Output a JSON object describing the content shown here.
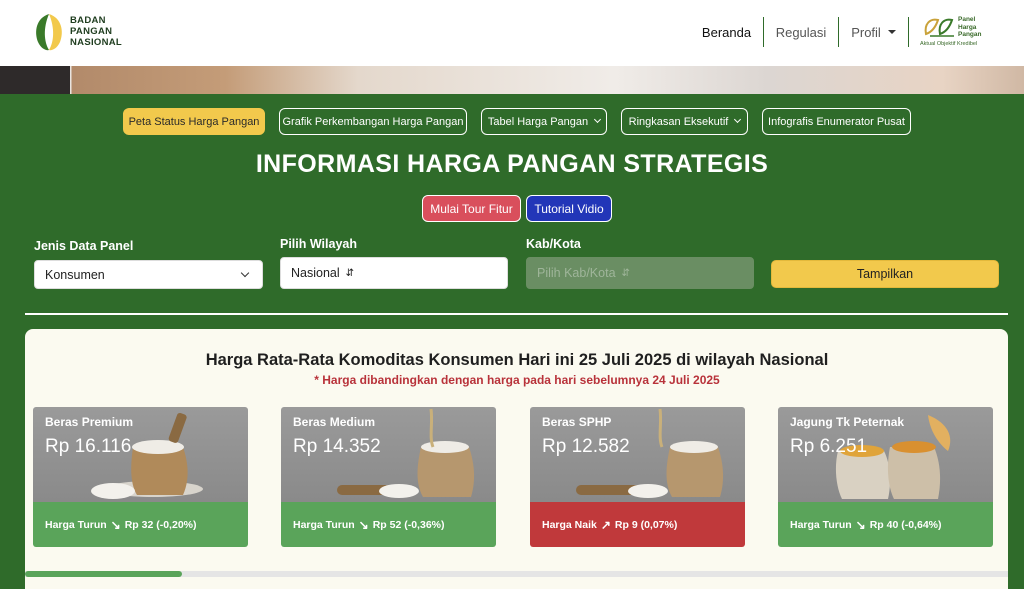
{
  "header": {
    "logo_lines": [
      "BADAN",
      "PANGAN",
      "NASIONAL"
    ],
    "nav": {
      "beranda": "Beranda",
      "regulasi": "Regulasi",
      "profil": "Profil"
    },
    "panel_logo": {
      "lines": [
        "Panel",
        "Harga",
        "Pangan"
      ],
      "tagline": "Aktual Objektif Kredibel"
    }
  },
  "tabs": [
    {
      "label": "Peta Status Harga Pangan",
      "active": true
    },
    {
      "label": "Grafik Perkembangan Harga Pangan",
      "active": false
    },
    {
      "label": "Tabel Harga Pangan",
      "active": false,
      "dropdown": true
    },
    {
      "label": "Ringkasan Eksekutif",
      "active": false,
      "dropdown": true
    },
    {
      "label": "Infografis Enumerator Pusat",
      "active": false
    }
  ],
  "main_title": "INFORMASI HARGA PANGAN STRATEGIS",
  "buttons": {
    "tour": "Mulai Tour Fitur",
    "video": "Tutorial Vidio",
    "show": "Tampilkan"
  },
  "filters": {
    "jenis": {
      "label": "Jenis Data Panel",
      "value": "Konsumen"
    },
    "wilayah": {
      "label": "Pilih Wilayah",
      "value": "Nasional"
    },
    "kabkota": {
      "label": "Kab/Kota",
      "placeholder": "Pilih Kab/Kota"
    }
  },
  "summary": {
    "title": "Harga Rata-Rata Komoditas Konsumen Hari ini 25 Juli 2025 di wilayah Nasional",
    "subtitle": "* Harga dibandingkan dengan harga pada hari sebelumnya 24 Juli 2025"
  },
  "cards": [
    {
      "name": "Beras Premium",
      "price": "Rp 16.116",
      "status": "Harga Turun",
      "direction": "down",
      "change": "Rp 32 (-0,20%)",
      "color": "#5aa45a"
    },
    {
      "name": "Beras Medium",
      "price": "Rp 14.352",
      "status": "Harga Turun",
      "direction": "down",
      "change": "Rp 52 (-0,36%)",
      "color": "#5aa45a"
    },
    {
      "name": "Beras SPHP",
      "price": "Rp 12.582",
      "status": "Harga Naik",
      "direction": "up",
      "change": "Rp 9 (0,07%)",
      "color": "#c0393b"
    },
    {
      "name": "Jagung Tk Peternak",
      "price": "Rp 6.251",
      "status": "Harga Turun",
      "direction": "down",
      "change": "Rp 40 (-0,64%)",
      "color": "#5aa45a"
    }
  ],
  "colors": {
    "primary_green": "#2f6b2a",
    "accent_yellow": "#f2c94c",
    "up_red": "#c0393b",
    "down_green": "#5aa45a"
  }
}
